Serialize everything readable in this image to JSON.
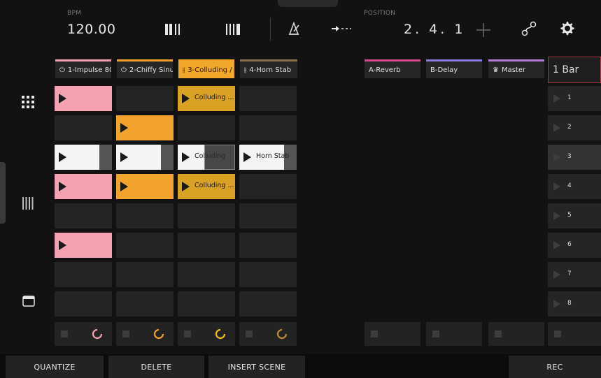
{
  "top": {
    "bpm_label": "BPM",
    "bpm_value": "120.00",
    "position_label": "POSITION",
    "position_value": "2. 4. 1"
  },
  "icons": {
    "view_a": "columns-thick-icon",
    "view_b": "columns-thin-icon",
    "metronome": "metronome-icon",
    "follow": "arrow-right-dashed-icon",
    "add": "plus-icon",
    "connect": "node-connect-icon",
    "settings": "gear-icon",
    "grid": "grid-view-icon",
    "mixer": "mixer-view-icon",
    "window": "window-icon"
  },
  "tracks": [
    {
      "name": "1-Impulse 80",
      "glyph": "⏻",
      "color": "#f4a2b1",
      "selected": false
    },
    {
      "name": "2-Chiffy Sinu",
      "glyph": "⏻",
      "color": "#f2a32e",
      "selected": false
    },
    {
      "name": "3-Colluding /",
      "glyph": "⫲",
      "color": "#f0a72a",
      "selected": true
    },
    {
      "name": "4-Horn Stab",
      "glyph": "⫲",
      "color": "#8a6d4a",
      "selected": false
    }
  ],
  "clips": [
    {
      "label": "Colluding ..."
    },
    {
      "label": "Colluding"
    },
    {
      "label": "Horn Stab"
    },
    {
      "label": "Colluding ..."
    }
  ],
  "playing_progress": [
    0.22,
    0.22,
    0.4,
    0.22
  ],
  "returns": [
    {
      "name": "A-Reverb",
      "color": "#d54a8d"
    },
    {
      "name": "B-Delay",
      "color": "#8a7ae0"
    },
    {
      "name": "Master",
      "glyph": "♛",
      "color": "#b47bd8"
    }
  ],
  "scene_header": "1 Bar",
  "scenes": [
    "1",
    "2",
    "3",
    "4",
    "5",
    "6",
    "7",
    "8"
  ],
  "current_scene": "3",
  "bottom": {
    "quantize": "QUANTIZE",
    "delete": "DELETE",
    "insert_scene": "INSERT SCENE",
    "rec": "REC"
  },
  "colors": {
    "pink": "#f4a2b1",
    "orange": "#f2a32e",
    "gold": "#d9a225",
    "scene_border": "#b5364a"
  }
}
